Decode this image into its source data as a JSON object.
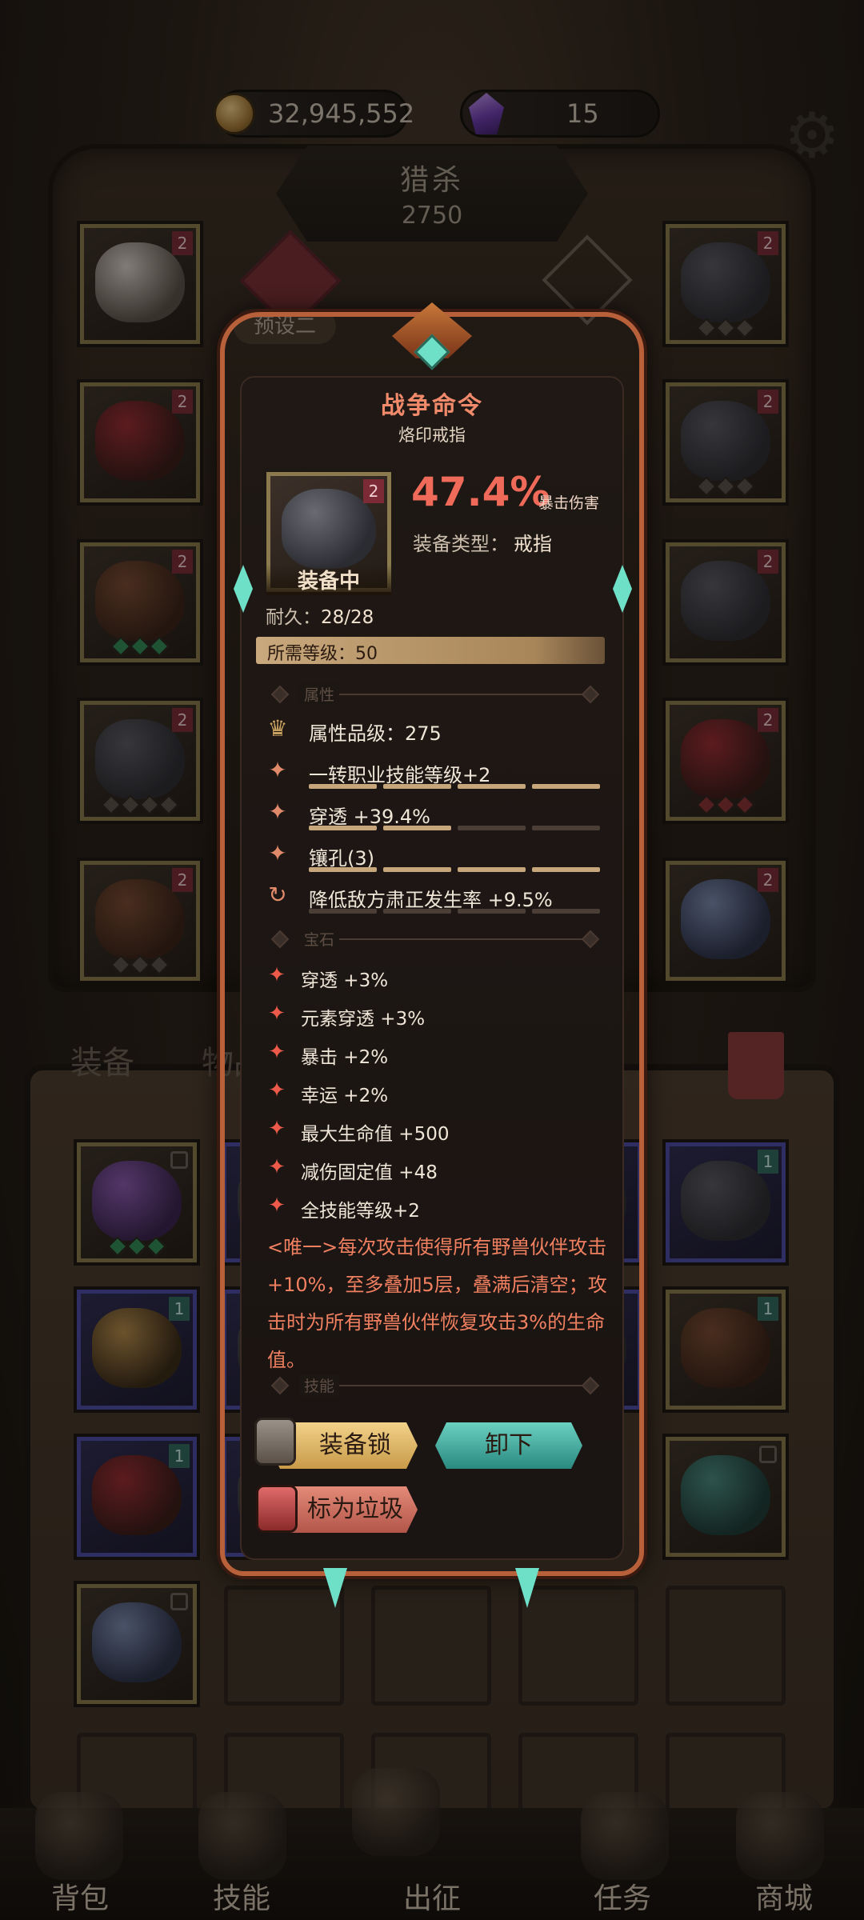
{
  "currency": {
    "gold": "32,945,552",
    "gems": "15"
  },
  "hunt": {
    "title": "猎杀",
    "value": "2750"
  },
  "preset_label": "预设二",
  "slot_tag": "2",
  "inventory_tag": "1",
  "inventory_tabs": {
    "equipment": "装备",
    "items": "物品"
  },
  "tooltip": {
    "name": "战争命令",
    "subtitle": "烙印戒指",
    "tier_tag": "2",
    "equipped_label": "装备中",
    "main_stat_value": "47.4%",
    "main_stat_name": "暴击伤害",
    "type_label": "装备类型：",
    "type_value": "戒指",
    "durability_label": "耐久：",
    "durability_value": "28/28",
    "required_level_label": "所需等级：",
    "required_level_value": "50",
    "section_attributes": "属性",
    "attributes": [
      {
        "icon": "crown-icon",
        "text": "属性品级：275",
        "fill": 0
      },
      {
        "icon": "diamond-icon",
        "text": "一转职业技能等级+2",
        "fill": 1
      },
      {
        "icon": "diamond-icon",
        "text": "穿透 +39.4%",
        "fill": 0.5
      },
      {
        "icon": "diamond-icon",
        "text": "镶孔(3)",
        "fill": 1
      },
      {
        "icon": "cycle-icon",
        "text": "降低敌方肃正发生率 +9.5%",
        "fill": 0
      }
    ],
    "section_gems": "宝石",
    "gems": [
      "穿透 +3%",
      "元素穿透 +3%",
      "暴击 +2%",
      "幸运 +2%",
      "最大生命值 +500",
      "减伤固定值 +48",
      "全技能等级+2"
    ],
    "unique_text": "<唯一>每次攻击使得所有野兽伙伴攻击+10%，至多叠加5层，叠满后清空；攻击时为所有野兽伙伴恢复攻击3%的生命值。",
    "section_skills": "技能",
    "buttons": {
      "lock": "装备锁",
      "unequip": "卸下",
      "mark_junk": "标为垃圾"
    }
  },
  "nav": [
    "背包",
    "技能",
    "出征",
    "任务",
    "商城"
  ],
  "colors": {
    "accent": "#f06a5a",
    "teal": "#6fe0c8",
    "gold": "#c6a67a"
  }
}
